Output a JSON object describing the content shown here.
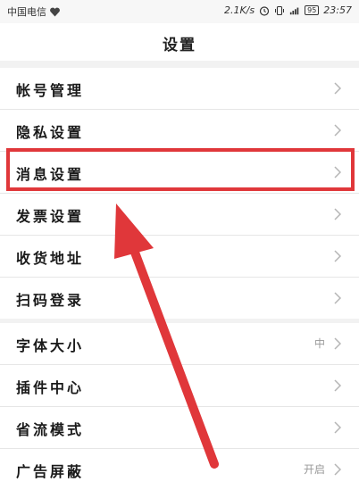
{
  "status_bar": {
    "carrier": "中国电信",
    "speed": "2.1K/s",
    "battery": "95",
    "time": "23:57"
  },
  "header": {
    "title": "设置"
  },
  "group1": [
    {
      "label": "帐号管理"
    },
    {
      "label": "隐私设置"
    },
    {
      "label": "消息设置"
    },
    {
      "label": "发票设置"
    },
    {
      "label": "收货地址"
    },
    {
      "label": "扫码登录"
    }
  ],
  "group2": [
    {
      "label": "字体大小",
      "value": "中"
    },
    {
      "label": "插件中心"
    },
    {
      "label": "省流模式"
    },
    {
      "label": "广告屏蔽",
      "value": "开启"
    }
  ],
  "colors": {
    "highlight": "#e0373a",
    "background": "#f2f2f2"
  },
  "icons": {
    "heart": "heart-icon",
    "alarm": "alarm-icon",
    "signal": "signal-icon",
    "chevron": "chevron-right-icon"
  }
}
